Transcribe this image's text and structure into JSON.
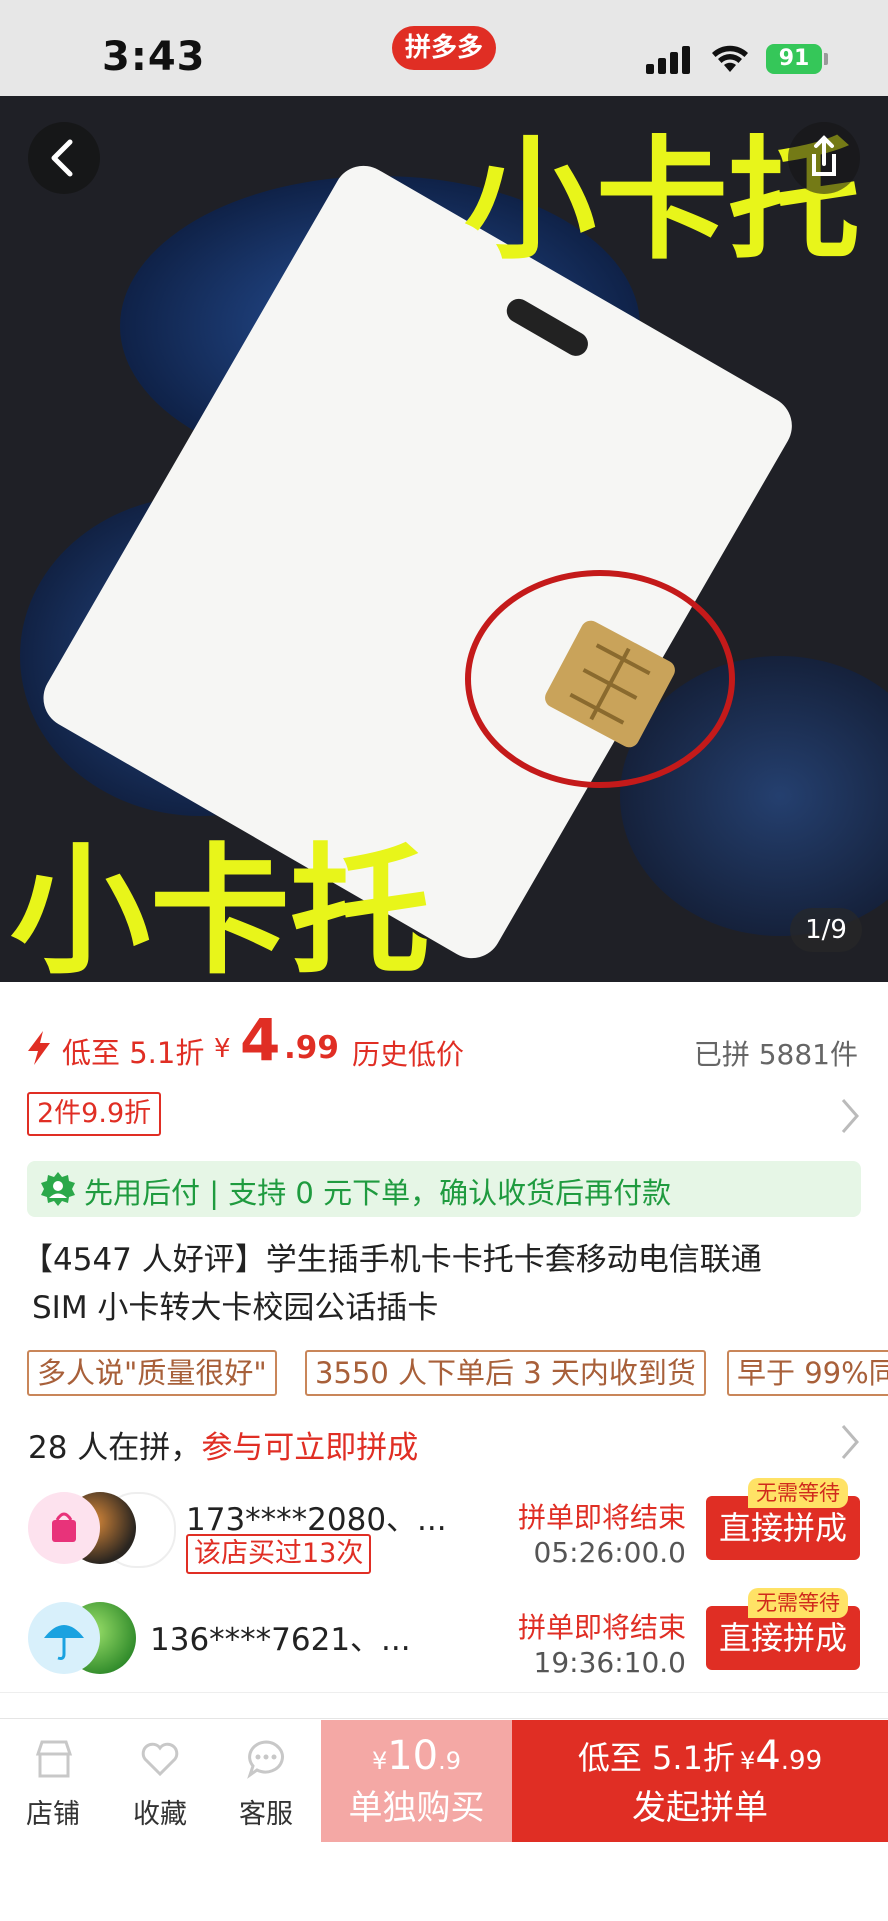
{
  "status_bar": {
    "time": "3:43",
    "app_badge": "拼多多",
    "battery": "91"
  },
  "hero": {
    "overlay_text_top": "小卡托",
    "overlay_text_bottom": "小卡托",
    "image_counter": "1/9"
  },
  "price": {
    "low_label": "低至 5.1折",
    "currency": "¥",
    "integer": "4",
    "decimal": ".99",
    "history_label": "历史低价",
    "sold": "已拼 5881件",
    "discount_tag": "2件9.9折"
  },
  "payment_banner": {
    "text": "先用后付 | 支持 0 元下单，确认收货后再付款"
  },
  "product": {
    "title_line1": "【4547 人好评】学生插手机卡卡托卡套移动电信联通",
    "title_line2": "SIM 小卡转大卡校园公话插卡"
  },
  "tags": [
    "多人说\"质量很好\"",
    "3550 人下单后 3 天内收到货",
    "早于 99%同"
  ],
  "group": {
    "count_text": "28 人在拼，",
    "join_text": "参与可立即拼成",
    "items": [
      {
        "name": "173****2080、...",
        "badge": "该店买过13次",
        "status": "拼单即将结束",
        "countdown": "05:26:00.0",
        "button": "直接拼成",
        "no_wait": "无需等待"
      },
      {
        "name": "136****7621、...",
        "badge": "",
        "status": "拼单即将结束",
        "countdown": "19:36:10.0",
        "button": "直接拼成",
        "no_wait": "无需等待"
      }
    ]
  },
  "bottom_bar": {
    "nav": [
      {
        "label": "店铺",
        "icon": "store-icon"
      },
      {
        "label": "收藏",
        "icon": "heart-icon"
      },
      {
        "label": "客服",
        "icon": "chat-icon"
      }
    ],
    "solo": {
      "currency": "¥",
      "integer": "10",
      "decimal": ".9",
      "label": "单独购买"
    },
    "group_buy": {
      "low_label": "低至 5.1折",
      "currency": "¥",
      "integer": "4",
      "decimal": ".99",
      "label": "发起拼单"
    }
  },
  "colors": {
    "brand_red": "#e02e24",
    "solo_pink": "#f4a8a5",
    "pay_green": "#1f9b3f",
    "overlay_yellow": "#e8f51a"
  }
}
